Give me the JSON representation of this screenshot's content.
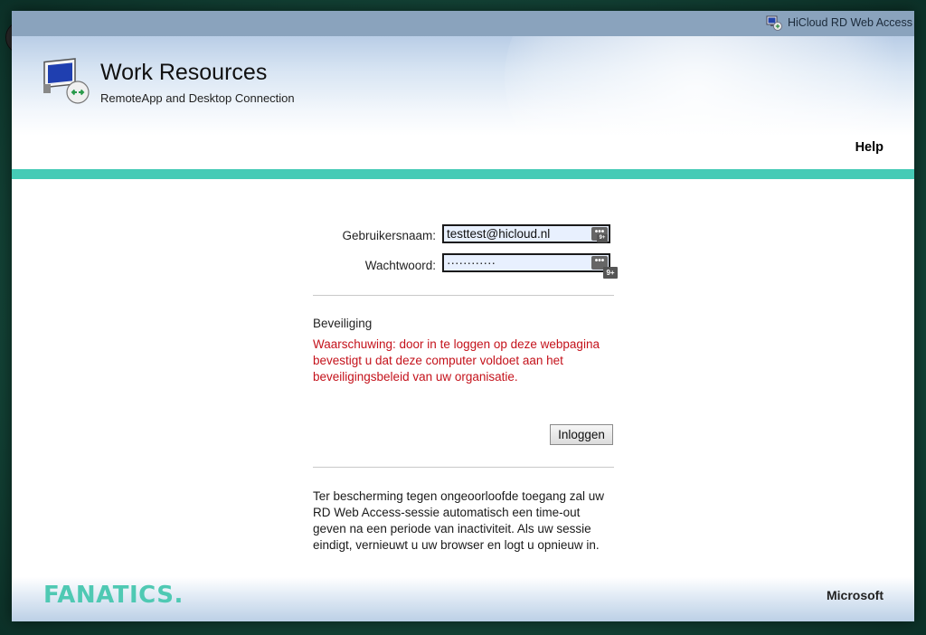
{
  "titlebar": {
    "icon": "rdweb-icon",
    "title": "HiCloud RD Web Access"
  },
  "header": {
    "app_icon": "remote-desktop-icon",
    "title": "Work Resources",
    "subtitle": "RemoteApp and Desktop Connection"
  },
  "nav": {
    "help_label": "Help"
  },
  "login": {
    "username_label": "Gebruikersnaam:",
    "username_value": "testtest@hicloud.nl",
    "password_label": "Wachtwoord:",
    "password_value": "············",
    "pm_icon_text": "•••",
    "pm_badge_text": "9+"
  },
  "security": {
    "heading": "Beveiliging",
    "warning": "Waarschuwing: door in te loggen op deze webpagina bevestigt u dat deze computer voldoet aan het beveiligingsbeleid van uw organisatie."
  },
  "actions": {
    "login_label": "Inloggen"
  },
  "timeout_note": "Ter bescherming tegen ongeoorloofde toegang zal uw RD Web Access-sessie automatisch een time-out geven na een periode van inactiviteit. Als uw sessie eindigt, vernieuwt u uw browser en logt u opnieuw in.",
  "footer": {
    "brand": "FANATICS.",
    "vendor": "Microsoft"
  },
  "colors": {
    "accent": "#45cbb6",
    "warning": "#c4121b",
    "brand": "#4fc9b3",
    "titlebar": "#8aa3bd"
  }
}
